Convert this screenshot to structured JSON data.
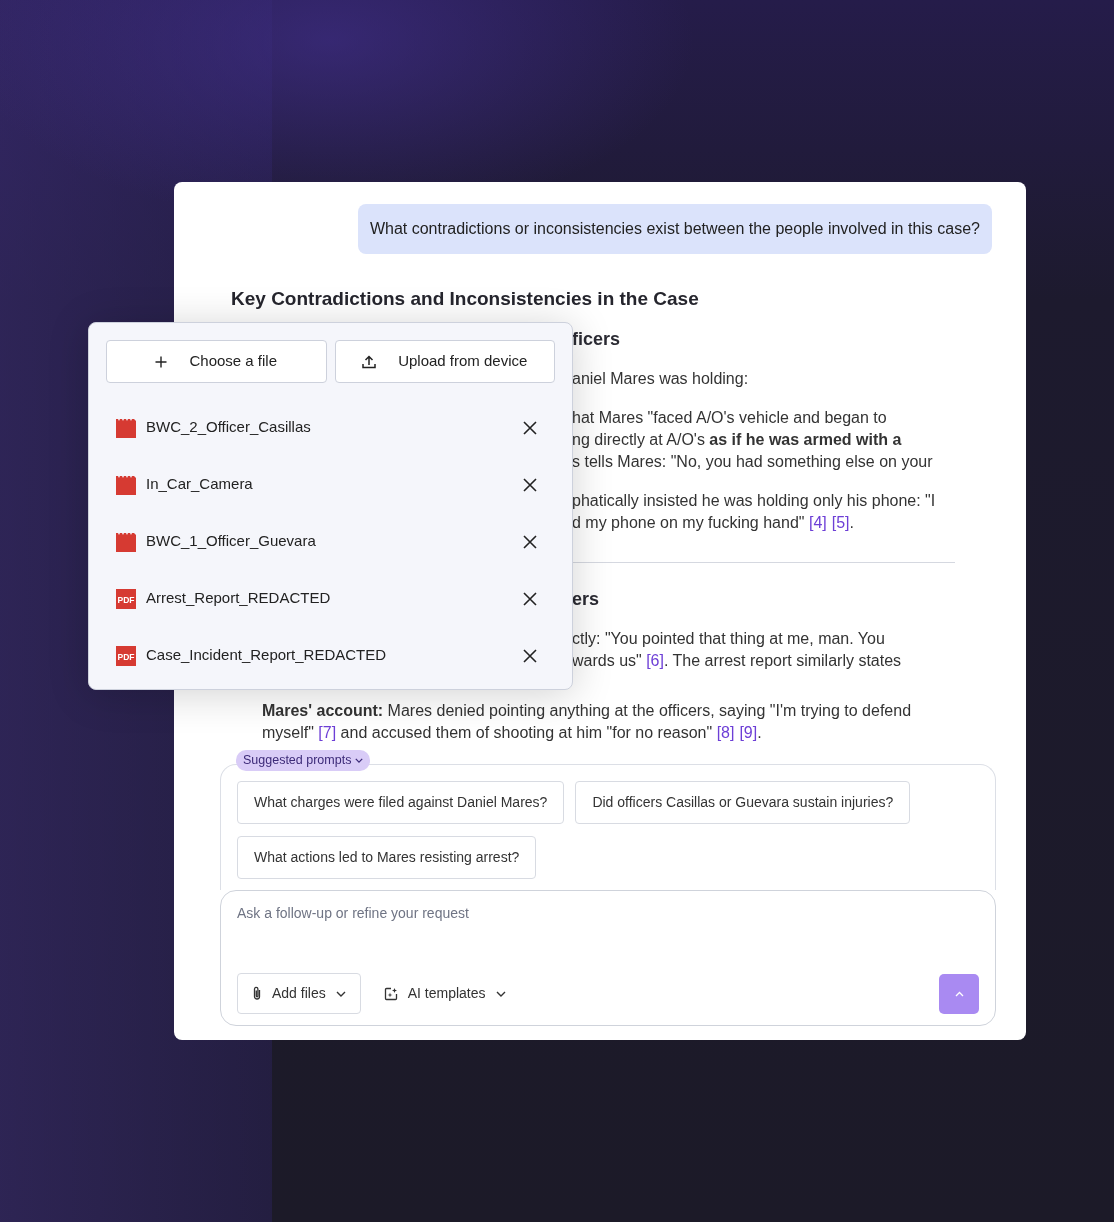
{
  "user_message": "What contradictions or inconsistencies exist between the people involved in this case?",
  "answer_title": "Key Contradictions and Inconsistencies in the Case",
  "partly_covered": [
    {
      "kind": "heading",
      "lines": [
        [
          {
            "kind": "text",
            "text": "ficers"
          }
        ]
      ]
    },
    {
      "kind": "paragraph",
      "lines": [
        [
          {
            "kind": "text",
            "text": "aniel Mares was holding:"
          }
        ]
      ]
    },
    {
      "kind": "paragraph",
      "lines": [
        [
          {
            "kind": "text",
            "text": "hat Mares \"faced A/O's vehicle and began to"
          }
        ],
        [
          {
            "kind": "text",
            "text": "ng directly at A/O's **as if he was armed with a**"
          }
        ],
        [
          {
            "kind": "text",
            "text": "s tells Mares: \"No, you had something else on your"
          }
        ]
      ]
    },
    {
      "kind": "paragraph",
      "lines": [
        [
          {
            "kind": "text",
            "text": "phatically insisted he was holding only his phone: \"I"
          }
        ],
        [
          {
            "kind": "text",
            "text": "d my phone on my fucking hand\" "
          },
          {
            "kind": "cite",
            "text": "[4]"
          },
          {
            "kind": "cite",
            "text": "[5]"
          },
          {
            "kind": "text",
            "text": "."
          }
        ]
      ]
    },
    {
      "kind": "divider"
    },
    {
      "kind": "heading",
      "lines": [
        [
          {
            "kind": "text",
            "text": "ers"
          }
        ]
      ]
    },
    {
      "kind": "paragraph",
      "lines": [
        [
          {
            "kind": "text",
            "text": "ctly: \"You pointed that thing at me, man. You"
          }
        ],
        [
          {
            "kind": "text",
            "text": "wards us\" "
          },
          {
            "kind": "cite",
            "text": "[6]"
          },
          {
            "kind": "text",
            "text": ". The arrest report similarly states"
          }
        ]
      ]
    }
  ],
  "answer_rest": [
    {
      "kind": "item",
      "lines": [
        [
          {
            "kind": "text",
            "text": "**Mares' account:** Mares denied pointing anything at the officers, saying \"I'm trying to defend"
          }
        ],
        [
          {
            "kind": "text",
            "text": "myself\" "
          },
          {
            "kind": "cite",
            "text": "[7]"
          },
          {
            "kind": "text",
            "text": " and accused them of shooting at him \"for no reason\" "
          },
          {
            "kind": "cite",
            "text": "[8]"
          },
          {
            "kind": "cite",
            "text": "[9]"
          },
          {
            "kind": "text",
            "text": "."
          }
        ]
      ]
    }
  ],
  "suggested": {
    "label": "Suggested prompts",
    "expanded": true,
    "prompts": [
      "What charges were filed against Daniel Mares?",
      "Did officers Casillas or Guevara sustain injuries?",
      "What actions led to Mares resisting arrest?"
    ]
  },
  "composer": {
    "placeholder": "Ask a follow-up or refine your request",
    "add_files": "Add files",
    "templates": "AI templates"
  },
  "file_menu": {
    "buttons": [
      {
        "kind": "choose",
        "label": "Choose a file"
      },
      {
        "kind": "upload",
        "label": "Upload from device"
      }
    ],
    "files": [
      {
        "kind": "video",
        "name": "BWC_2_Officer_Casillas"
      },
      {
        "kind": "video",
        "name": "In_Car_Camera"
      },
      {
        "kind": "video",
        "name": "BWC_1_Officer_Guevara"
      },
      {
        "kind": "pdf",
        "badge": "PDF",
        "name": "Arrest_Report_REDACTED"
      },
      {
        "kind": "pdf",
        "badge": "PDF",
        "name": "Case_Incident_Report_REDACTED"
      }
    ]
  }
}
